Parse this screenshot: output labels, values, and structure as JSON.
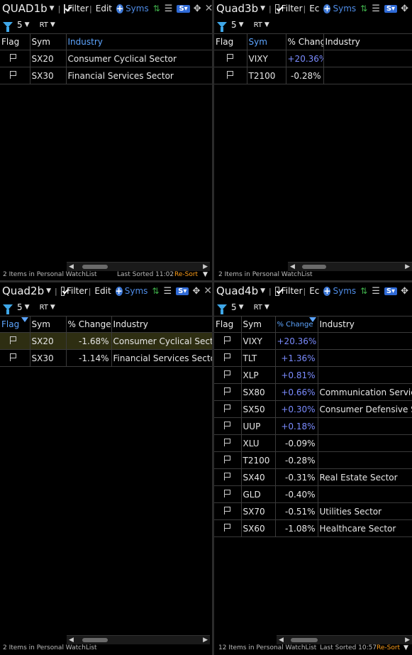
{
  "quads": {
    "q1": {
      "name": "QUAD1b",
      "filter_label": "Filter",
      "edit_label": "Edit",
      "syms_label": "Syms",
      "filter_count": "5",
      "rt_label": "RT",
      "columns": [
        "Flag",
        "Sym",
        "Industry"
      ],
      "rows": [
        {
          "sym": "SX20",
          "industry": "Consumer Cyclical Sector"
        },
        {
          "sym": "SX30",
          "industry": "Financial Services Sector"
        }
      ],
      "status": "2 Items in Personal WatchList",
      "last_sorted": "Last Sorted 11:02",
      "resort": "Re-Sort"
    },
    "q3": {
      "name": "Quad3b",
      "filter_label": "Filter",
      "edit_label": "Ec",
      "syms_label": "Syms",
      "filter_count": "5",
      "rt_label": "RT",
      "columns": [
        "Flag",
        "Sym",
        "% Change",
        "Industry"
      ],
      "rows": [
        {
          "sym": "VIXY",
          "change": "+20.36%",
          "industry": ""
        },
        {
          "sym": "T2100",
          "change": "-0.28%",
          "industry": ""
        }
      ],
      "status": "2 Items in Personal WatchList"
    },
    "q2": {
      "name": "Quad2b",
      "filter_label": "Filter",
      "edit_label": "Edit",
      "syms_label": "Syms",
      "filter_count": "5",
      "rt_label": "RT",
      "columns": [
        "Flag",
        "Sym",
        "% Change",
        "Industry"
      ],
      "rows": [
        {
          "sym": "SX20",
          "change": "-1.68%",
          "industry": "Consumer Cyclical Sector"
        },
        {
          "sym": "SX30",
          "change": "-1.14%",
          "industry": "Financial Services Sector"
        }
      ],
      "status": "2 Items in Personal WatchList"
    },
    "q4": {
      "name": "Quad4b",
      "filter_label": "Filter",
      "edit_label": "Ec",
      "syms_label": "Syms",
      "filter_count": "5",
      "rt_label": "RT",
      "columns": [
        "Flag",
        "Sym",
        "% Change",
        "Industry"
      ],
      "rows": [
        {
          "sym": "VIXY",
          "change": "+20.36%",
          "industry": ""
        },
        {
          "sym": "TLT",
          "change": "+1.36%",
          "industry": ""
        },
        {
          "sym": "XLP",
          "change": "+0.81%",
          "industry": ""
        },
        {
          "sym": "SX80",
          "change": "+0.66%",
          "industry": "Communication Services S"
        },
        {
          "sym": "SX50",
          "change": "+0.30%",
          "industry": "Consumer Defensive Secto"
        },
        {
          "sym": "UUP",
          "change": "+0.18%",
          "industry": ""
        },
        {
          "sym": "XLU",
          "change": "-0.09%",
          "industry": ""
        },
        {
          "sym": "T2100",
          "change": "-0.28%",
          "industry": ""
        },
        {
          "sym": "SX40",
          "change": "-0.31%",
          "industry": "Real Estate Sector"
        },
        {
          "sym": "GLD",
          "change": "-0.40%",
          "industry": ""
        },
        {
          "sym": "SX70",
          "change": "-0.51%",
          "industry": "Utilities Sector"
        },
        {
          "sym": "SX60",
          "change": "-1.08%",
          "industry": "Healthcare Sector"
        }
      ],
      "status": "12 Items in Personal WatchList",
      "last_sorted": "Last Sorted 10:57",
      "resort": "Re-Sort"
    }
  },
  "colors": {
    "positive": "#7b8cff",
    "accent_blue": "#5da5ff",
    "resort": "#ff9f1a",
    "selected_row": "#2e2e12"
  }
}
